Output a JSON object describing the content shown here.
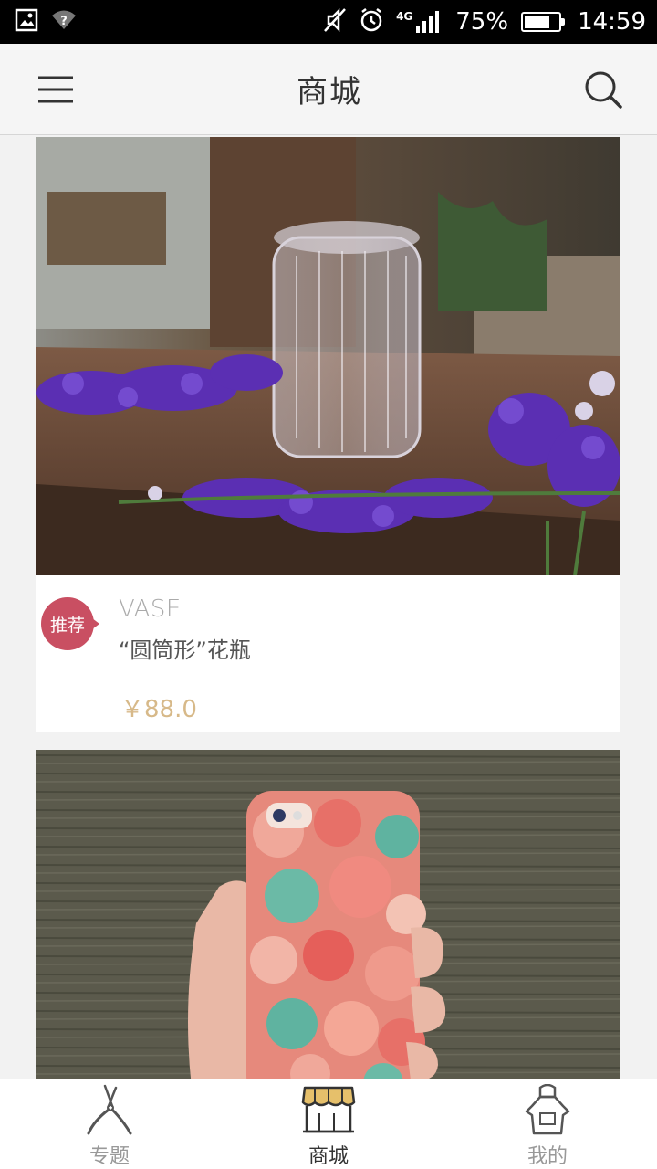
{
  "status_bar": {
    "network": "4G",
    "battery_percent": "75%",
    "battery_level": 0.75,
    "time": "14:59"
  },
  "header": {
    "title": "商城",
    "menu_icon": "menu-icon",
    "search_icon": "search-icon"
  },
  "products": [
    {
      "badge": "推荐",
      "category": "VASE",
      "name": "“圆筒形”花瓶",
      "price": "￥88.0",
      "image": "glass-vase-with-purple-flowers"
    },
    {
      "image": "floral-phone-case-in-hand"
    }
  ],
  "bottom_nav": {
    "items": [
      {
        "label": "专题",
        "icon": "pruning-shears-icon",
        "active": false
      },
      {
        "label": "商城",
        "icon": "storefront-icon",
        "active": true
      },
      {
        "label": "我的",
        "icon": "apron-icon",
        "active": false
      }
    ]
  },
  "colors": {
    "accent_badge": "#c94f62",
    "price": "#d7b989",
    "awning": "#e6c06b"
  }
}
